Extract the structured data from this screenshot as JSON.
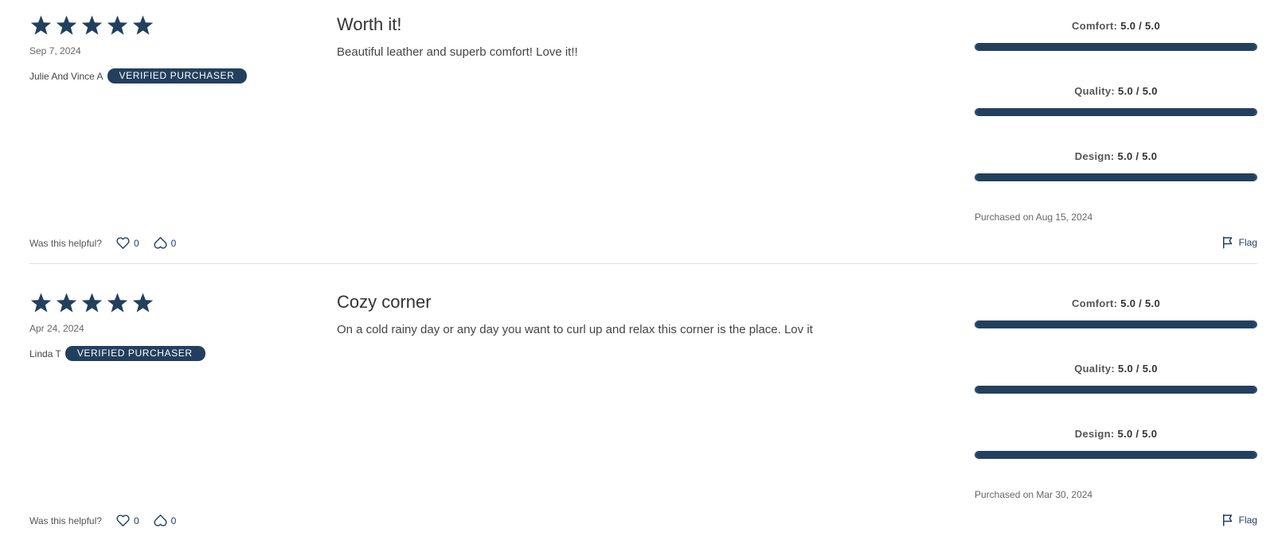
{
  "colors": {
    "accent": "#22405e",
    "divider": "#e3e3e3"
  },
  "reviews": [
    {
      "rating": 5,
      "date": "Sep 7, 2024",
      "reviewer": "Julie And Vince A",
      "badge": "VERIFIED PURCHASER",
      "title": "Worth it!",
      "body": "Beautiful leather and superb comfort! Love it!!",
      "ratings": [
        {
          "label": "Comfort:",
          "score": "5.0 / 5.0",
          "value": 5.0,
          "max": 5.0
        },
        {
          "label": "Quality:",
          "score": "5.0 / 5.0",
          "value": 5.0,
          "max": 5.0
        },
        {
          "label": "Design:",
          "score": "5.0 / 5.0",
          "value": 5.0,
          "max": 5.0
        }
      ],
      "purchased": "Purchased on Aug 15, 2024",
      "helpful_label": "Was this helpful?",
      "upvotes": "0",
      "downvotes": "0",
      "flag_label": "Flag"
    },
    {
      "rating": 5,
      "date": "Apr 24, 2024",
      "reviewer": "Linda T",
      "badge": "VERIFIED PURCHASER",
      "title": "Cozy corner",
      "body": "On a cold rainy day or any day you want to curl up and relax this corner is the place. Lov it",
      "ratings": [
        {
          "label": "Comfort:",
          "score": "5.0 / 5.0",
          "value": 5.0,
          "max": 5.0
        },
        {
          "label": "Quality:",
          "score": "5.0 / 5.0",
          "value": 5.0,
          "max": 5.0
        },
        {
          "label": "Design:",
          "score": "5.0 / 5.0",
          "value": 5.0,
          "max": 5.0
        }
      ],
      "purchased": "Purchased on Mar 30, 2024",
      "helpful_label": "Was this helpful?",
      "upvotes": "0",
      "downvotes": "0",
      "flag_label": "Flag"
    }
  ],
  "icons": {
    "star": "star-icon",
    "upvote": "heart-icon",
    "downvote": "thumbs-down-icon",
    "flag": "flag-icon"
  }
}
